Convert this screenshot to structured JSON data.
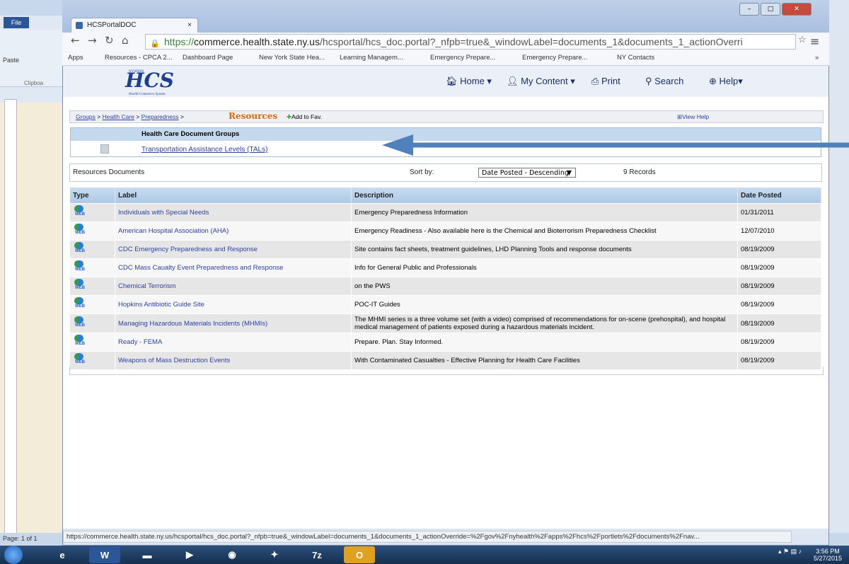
{
  "word": {
    "file_label": "File",
    "paste_label": "Paste",
    "clipboard_label": "Clipboa",
    "page_status": "Page: 1 of 1"
  },
  "browser": {
    "tab_title": "HCSPortalDOC",
    "tab_close": "×",
    "url_scheme": "https://",
    "url_host": "commerce.health.state.ny.us",
    "url_path": "/hcsportal/hcs_doc.portal?_nfpb=true&_windowLabel=documents_1&documents_1_actionOverri",
    "bookmarks": [
      "Apps",
      "Resources - CPCA 2...",
      "Dashboard Page",
      "New York State Hea...",
      "Learning Managem...",
      "Emergency Prepare...",
      "Emergency Prepare...",
      "NY Contacts"
    ],
    "bookmarks_more": "»",
    "status_url": "https://commerce.health.state.ny.us/hcsportal/hcs_doc.portal?_nfpb=true&_windowLabel=documents_1&documents_1_actionOverride=%2Fgov%2Fnyhealth%2Fapps%2Fhcs%2Fportlets%2Fdocuments%2Fnav..."
  },
  "portal": {
    "logo_text": "HCS",
    "logo_top": "NYSDOH",
    "logo_sub": "Health Commerce System",
    "nav": {
      "home": "Home ▾",
      "my_content": "My Content ▾",
      "print": "Print",
      "search": "Search",
      "help": "Help▾"
    },
    "breadcrumb": {
      "groups": "Groups",
      "health_care": "Health Care",
      "preparedness": "Preparedness",
      "resources": "Resources",
      "add_fav": "Add to Fav.",
      "view_help": "View Help"
    },
    "groups_header": "Health Care Document Groups",
    "group_link": "Transportation Assistance Levels (TALs)",
    "docs_line": {
      "label": "Resources Documents",
      "sort_label": "Sort by:",
      "sort_value": "Date Posted - Descending",
      "records": "9 Records"
    },
    "table": {
      "headers": [
        "Type",
        "Label",
        "Description",
        "Date Posted"
      ],
      "type_text": "WEB",
      "rows": [
        {
          "label": "Individuals with Special Needs",
          "description": "Emergency Preparedness Information",
          "date": "01/31/2011"
        },
        {
          "label": "American Hospital Association (AHA)",
          "description": "Emergency Readiness - Also available here is the Chemical and Bioterrorism Preparedness Checklist",
          "date": "12/07/2010"
        },
        {
          "label": "CDC Emergency Preparedness and Response",
          "description": "Site contains fact sheets, treatment guidelines, LHD Planning Tools and response documents",
          "date": "08/19/2009"
        },
        {
          "label": "CDC Mass Caualty Event Preparedness and Response",
          "description": "Info for General Public and Professionals",
          "date": "08/19/2009"
        },
        {
          "label": "Chemical Terrorism",
          "description": "on the PWS",
          "date": "08/19/2009"
        },
        {
          "label": "Hopkins Antibiotic Guide Site",
          "description": "POC-IT Guides",
          "date": "08/19/2009"
        },
        {
          "label": "Managing Hazardous Materials Incidents (MHMIs)",
          "description": "The MHMI series is a three volume set (with a video) comprised of recommendations for on-scene (prehospital), and hospital medical management of patients exposed during a hazardous materials incident.",
          "date": "08/19/2009"
        },
        {
          "label": "Ready - FEMA",
          "description": "Prepare. Plan. Stay Informed.",
          "date": "08/19/2009"
        },
        {
          "label": "Weapons of Mass Destruction Events",
          "description": "With Contaminated Casualties - Effective Planning for Health Care Facilities",
          "date": "08/19/2009"
        }
      ]
    }
  },
  "taskbar": {
    "time": "3:56 PM",
    "date": "5/27/2015"
  }
}
